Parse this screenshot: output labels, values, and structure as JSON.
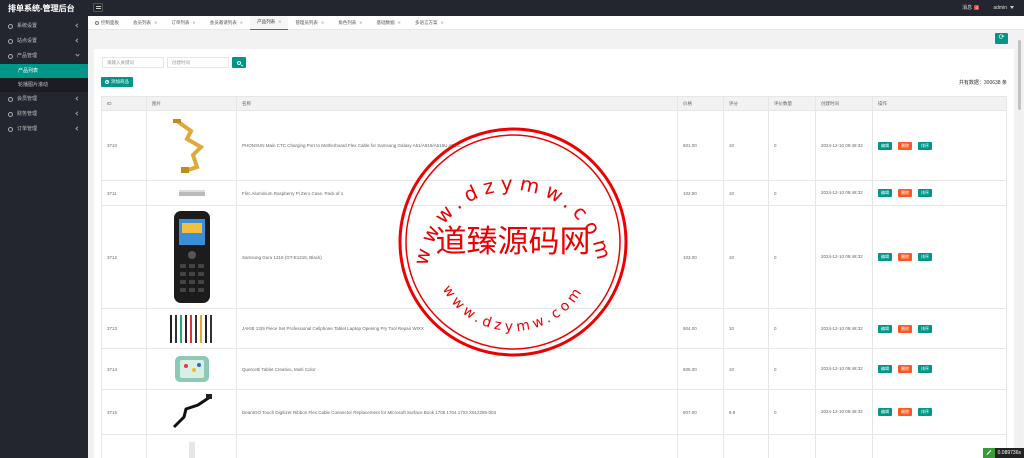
{
  "app": {
    "title": "排单系统-管理后台"
  },
  "header": {
    "message_label": "消息",
    "message_count": "0",
    "user": "admin"
  },
  "sidebar": {
    "items": [
      {
        "label": "系统设置",
        "icon": "gear-icon"
      },
      {
        "label": "站点设置",
        "icon": "globe-icon"
      },
      {
        "label": "产品管理",
        "icon": "box-icon",
        "children": [
          {
            "label": "产品列表",
            "active": true
          },
          {
            "label": "轮播图片滚动",
            "active": false
          }
        ]
      },
      {
        "label": "会员管理",
        "icon": "user-icon"
      },
      {
        "label": "财务管理",
        "icon": "money-icon"
      },
      {
        "label": "订单管理",
        "icon": "order-icon"
      }
    ]
  },
  "tabs": [
    {
      "label": "控制面板",
      "active": false
    },
    {
      "label": "会员列表",
      "active": false
    },
    {
      "label": "订单列表",
      "active": false
    },
    {
      "label": "会员邀请列表",
      "active": false
    },
    {
      "label": "产品列表",
      "active": true
    },
    {
      "label": "管理员列表",
      "active": false
    },
    {
      "label": "角色列表",
      "active": false
    },
    {
      "label": "基础数据",
      "active": false
    },
    {
      "label": "多语言方案",
      "active": false
    }
  ],
  "search": {
    "name_placeholder": "请输入关键词",
    "date_placeholder": "创建时间"
  },
  "toolbar": {
    "add_label": "添加商品",
    "total_label": "共有数据：",
    "total_value": "300638",
    "total_unit": "条"
  },
  "table": {
    "headers": [
      "ID",
      "图片",
      "名称",
      "价格",
      "评分",
      "评价数量",
      "创建时间",
      "操作"
    ],
    "actions": {
      "edit": "编辑",
      "delete": "删除",
      "sort": "排序"
    },
    "rows": [
      {
        "id": "3710",
        "name": "PHONSUN Main CTC Charging Port to Motherboard Flex Cable for Samsung Galaxy A51/A515/A515U A515...",
        "price": "501.00",
        "score": "10",
        "reviews": "0",
        "time": "2024-12-10 09:48:32",
        "image": "flex-cable-image"
      },
      {
        "id": "3711",
        "name": "Flirc Aluminium Raspberry Pi Zero Case, Pack of 1",
        "price": "102.00",
        "score": "10",
        "reviews": "0",
        "time": "2024-12-10 09:48:32",
        "image": "case-image"
      },
      {
        "id": "3712",
        "name": "Samsung Guru 1215 (GT-E1215, Black)",
        "price": "103.00",
        "score": "10",
        "reviews": "0",
        "time": "2024-12-10 09:48:32",
        "image": "phone-image"
      },
      {
        "id": "3713",
        "name": "JAKIB 13(9 Piece Set Professional Cellphone Tablet Laptop Opening Pry Tool Repair WIXX",
        "price": "504.00",
        "score": "10",
        "reviews": "0",
        "time": "2024-12-10 09:48:32",
        "image": "tools-image"
      },
      {
        "id": "3714",
        "name": "Quercetti Tablet Creativo, Multi Color",
        "price": "505.00",
        "score": "10",
        "reviews": "0",
        "time": "2024-12-10 09:48:32",
        "image": "toy-tablet-image"
      },
      {
        "id": "3715",
        "name": "DeanIGO Touch Digitizer Ribbon Flex Cable Connector Replacement for Microsoft Surface Book 1705 1704 1703 X912285-003",
        "price": "507.00",
        "score": "8.9",
        "reviews": "0",
        "time": "2024-12-10 09:48:32",
        "image": "ribbon-cable-image"
      }
    ]
  },
  "watermark": {
    "center": "道臻源码网",
    "top_arc": "www.dzymw.com",
    "bottom_arc": "www.dzymw.com"
  },
  "perf": {
    "value": "0.089736s"
  },
  "colors": {
    "accent": "#009688",
    "danger": "#ff5722",
    "sidebar": "#23262e",
    "seal": "#ee0000"
  }
}
